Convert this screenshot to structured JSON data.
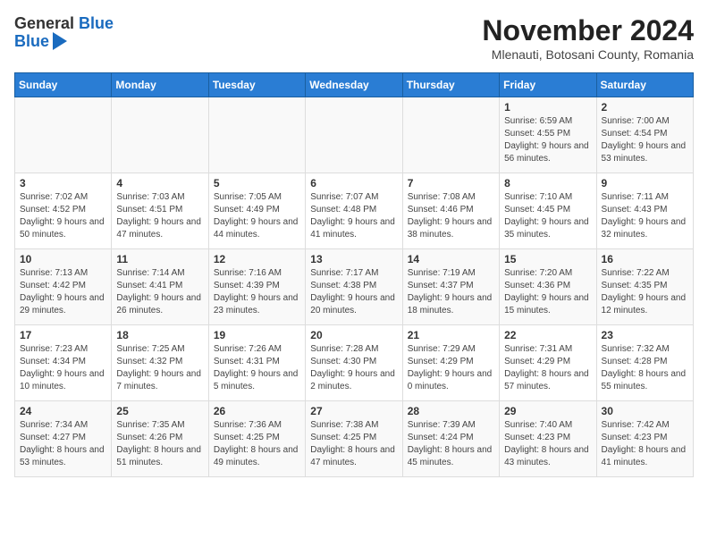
{
  "logo": {
    "line1": "General",
    "line2": "Blue"
  },
  "title": "November 2024",
  "location": "Mlenauti, Botosani County, Romania",
  "headers": [
    "Sunday",
    "Monday",
    "Tuesday",
    "Wednesday",
    "Thursday",
    "Friday",
    "Saturday"
  ],
  "weeks": [
    [
      {
        "day": "",
        "info": ""
      },
      {
        "day": "",
        "info": ""
      },
      {
        "day": "",
        "info": ""
      },
      {
        "day": "",
        "info": ""
      },
      {
        "day": "",
        "info": ""
      },
      {
        "day": "1",
        "info": "Sunrise: 6:59 AM\nSunset: 4:55 PM\nDaylight: 9 hours and 56 minutes."
      },
      {
        "day": "2",
        "info": "Sunrise: 7:00 AM\nSunset: 4:54 PM\nDaylight: 9 hours and 53 minutes."
      }
    ],
    [
      {
        "day": "3",
        "info": "Sunrise: 7:02 AM\nSunset: 4:52 PM\nDaylight: 9 hours and 50 minutes."
      },
      {
        "day": "4",
        "info": "Sunrise: 7:03 AM\nSunset: 4:51 PM\nDaylight: 9 hours and 47 minutes."
      },
      {
        "day": "5",
        "info": "Sunrise: 7:05 AM\nSunset: 4:49 PM\nDaylight: 9 hours and 44 minutes."
      },
      {
        "day": "6",
        "info": "Sunrise: 7:07 AM\nSunset: 4:48 PM\nDaylight: 9 hours and 41 minutes."
      },
      {
        "day": "7",
        "info": "Sunrise: 7:08 AM\nSunset: 4:46 PM\nDaylight: 9 hours and 38 minutes."
      },
      {
        "day": "8",
        "info": "Sunrise: 7:10 AM\nSunset: 4:45 PM\nDaylight: 9 hours and 35 minutes."
      },
      {
        "day": "9",
        "info": "Sunrise: 7:11 AM\nSunset: 4:43 PM\nDaylight: 9 hours and 32 minutes."
      }
    ],
    [
      {
        "day": "10",
        "info": "Sunrise: 7:13 AM\nSunset: 4:42 PM\nDaylight: 9 hours and 29 minutes."
      },
      {
        "day": "11",
        "info": "Sunrise: 7:14 AM\nSunset: 4:41 PM\nDaylight: 9 hours and 26 minutes."
      },
      {
        "day": "12",
        "info": "Sunrise: 7:16 AM\nSunset: 4:39 PM\nDaylight: 9 hours and 23 minutes."
      },
      {
        "day": "13",
        "info": "Sunrise: 7:17 AM\nSunset: 4:38 PM\nDaylight: 9 hours and 20 minutes."
      },
      {
        "day": "14",
        "info": "Sunrise: 7:19 AM\nSunset: 4:37 PM\nDaylight: 9 hours and 18 minutes."
      },
      {
        "day": "15",
        "info": "Sunrise: 7:20 AM\nSunset: 4:36 PM\nDaylight: 9 hours and 15 minutes."
      },
      {
        "day": "16",
        "info": "Sunrise: 7:22 AM\nSunset: 4:35 PM\nDaylight: 9 hours and 12 minutes."
      }
    ],
    [
      {
        "day": "17",
        "info": "Sunrise: 7:23 AM\nSunset: 4:34 PM\nDaylight: 9 hours and 10 minutes."
      },
      {
        "day": "18",
        "info": "Sunrise: 7:25 AM\nSunset: 4:32 PM\nDaylight: 9 hours and 7 minutes."
      },
      {
        "day": "19",
        "info": "Sunrise: 7:26 AM\nSunset: 4:31 PM\nDaylight: 9 hours and 5 minutes."
      },
      {
        "day": "20",
        "info": "Sunrise: 7:28 AM\nSunset: 4:30 PM\nDaylight: 9 hours and 2 minutes."
      },
      {
        "day": "21",
        "info": "Sunrise: 7:29 AM\nSunset: 4:29 PM\nDaylight: 9 hours and 0 minutes."
      },
      {
        "day": "22",
        "info": "Sunrise: 7:31 AM\nSunset: 4:29 PM\nDaylight: 8 hours and 57 minutes."
      },
      {
        "day": "23",
        "info": "Sunrise: 7:32 AM\nSunset: 4:28 PM\nDaylight: 8 hours and 55 minutes."
      }
    ],
    [
      {
        "day": "24",
        "info": "Sunrise: 7:34 AM\nSunset: 4:27 PM\nDaylight: 8 hours and 53 minutes."
      },
      {
        "day": "25",
        "info": "Sunrise: 7:35 AM\nSunset: 4:26 PM\nDaylight: 8 hours and 51 minutes."
      },
      {
        "day": "26",
        "info": "Sunrise: 7:36 AM\nSunset: 4:25 PM\nDaylight: 8 hours and 49 minutes."
      },
      {
        "day": "27",
        "info": "Sunrise: 7:38 AM\nSunset: 4:25 PM\nDaylight: 8 hours and 47 minutes."
      },
      {
        "day": "28",
        "info": "Sunrise: 7:39 AM\nSunset: 4:24 PM\nDaylight: 8 hours and 45 minutes."
      },
      {
        "day": "29",
        "info": "Sunrise: 7:40 AM\nSunset: 4:23 PM\nDaylight: 8 hours and 43 minutes."
      },
      {
        "day": "30",
        "info": "Sunrise: 7:42 AM\nSunset: 4:23 PM\nDaylight: 8 hours and 41 minutes."
      }
    ]
  ]
}
